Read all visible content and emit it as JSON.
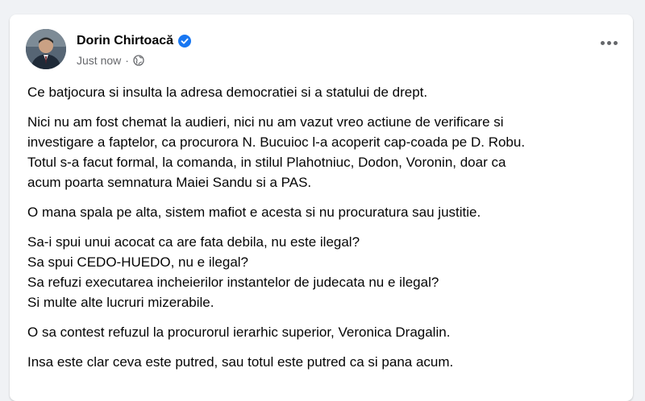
{
  "post": {
    "author": "Dorin Chirtoacă",
    "timestamp": "Just now",
    "separator": "·",
    "privacy_icon": "globe-icon",
    "verified_icon": "verified-badge-icon",
    "more_icon": "more-options-icon",
    "paragraphs": [
      "Ce batjocura si insulta la adresa democratiei si a statului de drept.",
      "Nici nu am fost chemat la audieri, nici nu am vazut vreo actiune de verificare si\ninvestigare a faptelor, ca procurora N. Bucuioc l-a acoperit cap-coada pe D. Robu.\nTotul s-a facut formal, la comanda, in stilul Plahotniuc, Dodon, Voronin, doar ca\nacum poarta semnatura Maiei Sandu si a PAS.",
      "O mana spala pe alta, sistem mafiot e acesta si nu procuratura sau justitie.",
      "Sa-i spui unui acocat ca are fata debila, nu este ilegal?\nSa spui CEDO-HUEDO, nu e ilegal?\nSa refuzi executarea incheierilor instantelor de judecata nu e ilegal?\nSi multe alte lucruri mizerabile.",
      "O sa contest refuzul la procurorul ierarhic superior, Veronica Dragalin.",
      "Insa este clar ceva este putred, sau totul este putred ca si pana acum."
    ]
  },
  "colors": {
    "background": "#f0f2f5",
    "card": "#ffffff",
    "text": "#050505",
    "secondary_text": "#65676b",
    "verified": "#1877f2"
  }
}
